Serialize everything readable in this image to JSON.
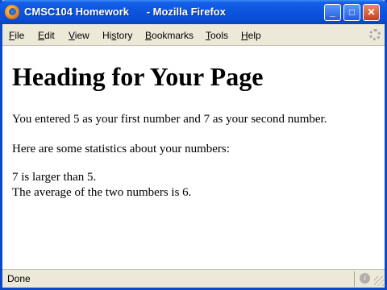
{
  "window": {
    "title": "CMSC104 Homework      - Mozilla Firefox"
  },
  "titlebar_buttons": {
    "minimize_glyph": "_",
    "maximize_glyph": "□",
    "close_glyph": "✕"
  },
  "menu": [
    {
      "prefix": "",
      "underline": "F",
      "rest": "ile"
    },
    {
      "prefix": "",
      "underline": "E",
      "rest": "dit"
    },
    {
      "prefix": "",
      "underline": "V",
      "rest": "iew"
    },
    {
      "prefix": "Hi",
      "underline": "s",
      "rest": "tory"
    },
    {
      "prefix": "",
      "underline": "B",
      "rest": "ookmarks"
    },
    {
      "prefix": "",
      "underline": "T",
      "rest": "ools"
    },
    {
      "prefix": "",
      "underline": "H",
      "rest": "elp"
    }
  ],
  "page": {
    "heading": "Heading for Your Page",
    "line1": "You entered 5 as your first number and 7 as your second number.",
    "line2": "Here are some statistics about your numbers:",
    "line3": "7 is larger than 5.",
    "line4": "The average of the two numbers is 6."
  },
  "status": {
    "text": "Done"
  },
  "icons": {
    "app": "firefox-icon",
    "throbber": "loading-throbber-icon",
    "status": "info-icon"
  }
}
